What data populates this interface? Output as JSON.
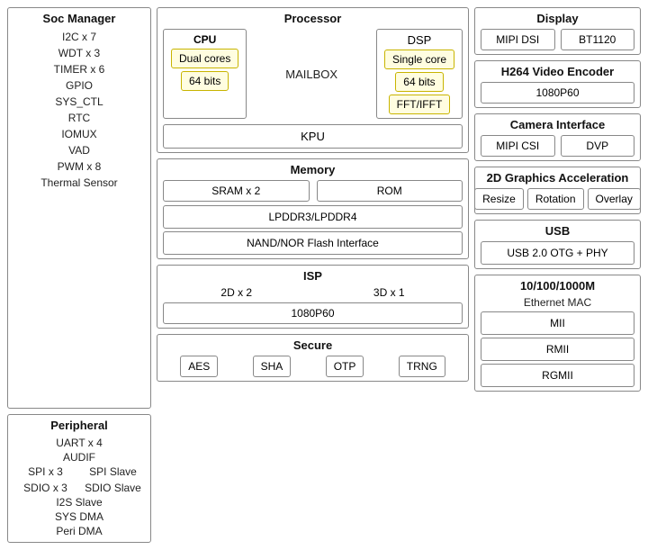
{
  "soc_manager": {
    "title": "Soc Manager",
    "items": [
      "I2C x 7",
      "WDT x 3",
      "TIMER x 6",
      "GPIO",
      "SYS_CTL",
      "RTC",
      "IOMUX",
      "VAD",
      "PWM x 8",
      "Thermal Sensor"
    ]
  },
  "peripheral": {
    "title": "Peripheral",
    "items_full": [
      "UART x 4",
      "AUDIF"
    ],
    "items_pair": [
      [
        "SPI x 3",
        "SPI Slave"
      ],
      [
        "SDIO x 3",
        "SDIO Slave"
      ]
    ],
    "items_full2": [
      "I2S Slave",
      "SYS DMA",
      "Peri DMA"
    ]
  },
  "processor": {
    "title": "Processor",
    "cpu_label": "CPU",
    "dual_cores": "Dual cores",
    "bits64": "64 bits",
    "mailbox": "MAILBOX",
    "dsp_label": "DSP",
    "single_core": "Single core",
    "dsp_bits": "64 bits",
    "fft": "FFT/IFFT",
    "kpu": "KPU"
  },
  "memory": {
    "title": "Memory",
    "sram": "SRAM x 2",
    "rom": "ROM",
    "lpddr": "LPDDR3/LPDDR4",
    "nand": "NAND/NOR Flash Interface"
  },
  "isp": {
    "title": "ISP",
    "left": "2D x 2",
    "right": "3D x 1",
    "bottom": "1080P60"
  },
  "secure": {
    "title": "Secure",
    "items": [
      "AES",
      "SHA",
      "OTP",
      "TRNG"
    ]
  },
  "display": {
    "title": "Display",
    "items": [
      "MIPI DSI",
      "BT1120"
    ]
  },
  "h264": {
    "title": "H264 Video Encoder",
    "item": "1080P60"
  },
  "camera": {
    "title": "Camera  Interface",
    "items": [
      "MIPI CSI",
      "DVP"
    ]
  },
  "graphics": {
    "title": "2D Graphics Acceleration",
    "items": [
      "Resize",
      "Rotation",
      "Overlay"
    ]
  },
  "usb": {
    "title": "USB",
    "item": "USB 2.0 OTG + PHY"
  },
  "ethernet": {
    "title": "10/100/1000M",
    "subtitle": "Ethernet MAC",
    "items": [
      "MII",
      "RMII",
      "RGMII"
    ]
  }
}
